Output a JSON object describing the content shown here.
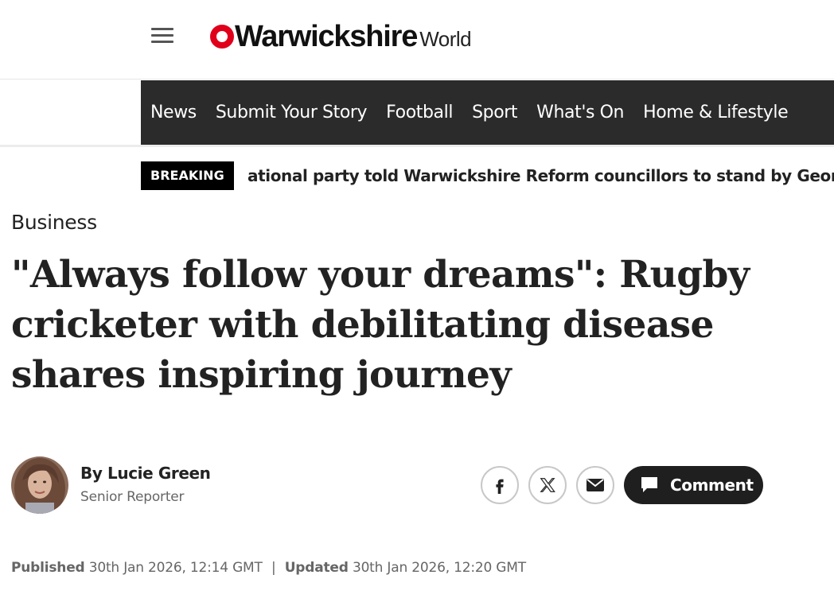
{
  "header": {
    "logo_main": "Warwickshire",
    "logo_sub": "World",
    "brand_color": "#e0001b"
  },
  "nav": {
    "items": [
      "News",
      "Submit Your Story",
      "Football",
      "Sport",
      "What's On",
      "Home & Lifestyle"
    ]
  },
  "breaking": {
    "label": "BREAKING",
    "text": "ational party told Warwickshire Reform councillors to stand by George Fi"
  },
  "article": {
    "section": "Business",
    "headline": "\"Always follow your dreams\": Rugby cricketer with debilitating disease shares inspiring journey",
    "author": {
      "name": "By Lucie Green",
      "role": "Senior Reporter"
    },
    "share": {
      "facebook_icon": "facebook-icon",
      "x_icon": "x-icon",
      "mail_icon": "mail-icon",
      "comment_label": "Comment"
    },
    "dates": {
      "published_label": "Published",
      "published_value": "30th Jan 2026, 12:14 GMT",
      "separator": "|",
      "updated_label": "Updated",
      "updated_value": "30th Jan 2026, 12:20 GMT"
    }
  }
}
